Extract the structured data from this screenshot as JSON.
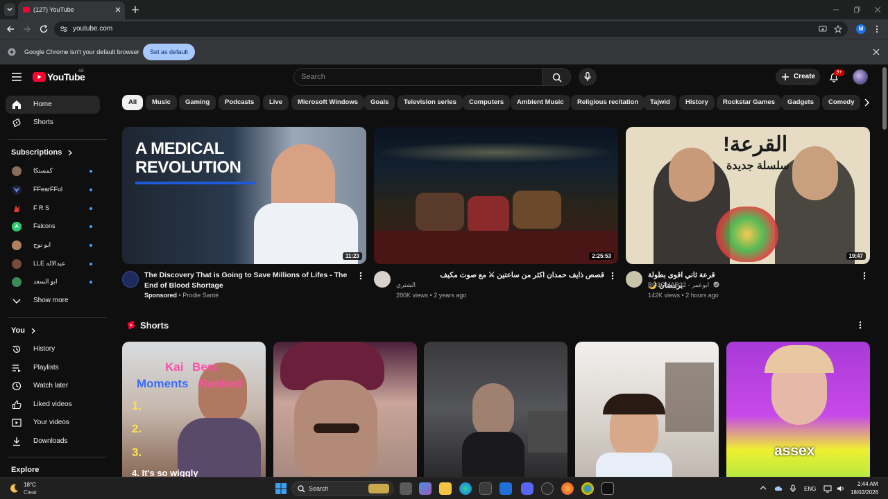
{
  "browser": {
    "tab_title": "(127) YouTube",
    "url": "youtube.com",
    "profile_initial": "M"
  },
  "infobar": {
    "message": "Google Chrome isn't your default browser",
    "button": "Set as default"
  },
  "masthead": {
    "logo_text": "YouTube",
    "country_code": "AE",
    "search_placeholder": "Search",
    "create_label": "Create",
    "notification_count": "9+"
  },
  "sidebar": {
    "main": [
      {
        "label": "Home",
        "icon": "home-icon",
        "active": true
      },
      {
        "label": "Shorts",
        "icon": "shorts-icon",
        "active": false
      }
    ],
    "subscriptions_heading": "Subscriptions",
    "subscriptions": [
      {
        "name": "كمستكا",
        "color": "#8a6d5a"
      },
      {
        "name": "FFearFFul",
        "color": "#2b3a8c"
      },
      {
        "name": "F R S",
        "color": "#c0392b"
      },
      {
        "name": "Falcons",
        "color": "#2ecc71"
      },
      {
        "name": "ابو نوح",
        "color": "#b08060"
      },
      {
        "name": "LLE عبدالاله",
        "color": "#7a4a3a"
      },
      {
        "name": "ابو السعد",
        "color": "#3a8a5a"
      }
    ],
    "show_more": "Show more",
    "you_heading": "You",
    "you_items": [
      {
        "label": "History",
        "icon": "history-icon"
      },
      {
        "label": "Playlists",
        "icon": "playlists-icon"
      },
      {
        "label": "Watch later",
        "icon": "watch-later-icon"
      },
      {
        "label": "Liked videos",
        "icon": "thumbs-up-icon"
      },
      {
        "label": "Your videos",
        "icon": "your-videos-icon"
      },
      {
        "label": "Downloads",
        "icon": "download-icon"
      }
    ],
    "explore_heading": "Explore"
  },
  "chips": [
    "All",
    "Music",
    "Gaming",
    "Podcasts",
    "Live",
    "Microsoft Windows",
    "Goals",
    "Television series",
    "Computers",
    "Ambient Music",
    "Religious recitation",
    "Tajwid",
    "History",
    "Rockstar Games",
    "Gadgets",
    "Comedy"
  ],
  "videos": [
    {
      "thumb_text_1": "A MEDICAL",
      "thumb_text_2": "REVOLUTION",
      "duration": "11:23",
      "title": "The Discovery That is Going to Save Millions of Lifes - The End of Blood Shortage",
      "sponsored": "Sponsored",
      "channel": "Prodie Santé"
    },
    {
      "duration": "2:25:53",
      "title": "قصص ذايف حمدان اكثر من ساعتين ⚔ مع صوت مكيف",
      "channel": "الشثري",
      "views": "280K views",
      "age": "2 years ago"
    },
    {
      "thumb_text_1": "القرعة!",
      "thumb_text_2": "سلسلة جديدة",
      "duration": "19:47",
      "title": "قرعة ثاني اقوى بطولة برمضان 🌙",
      "channel": "BO3OMAR22 - ابوعمر",
      "views": "142K views",
      "age": "2 hours ago"
    }
  ],
  "shorts": {
    "heading": "Shorts",
    "items": [
      {
        "overlay_1": "Kai",
        "overlay_2": "Best",
        "overlay_3": "Moments",
        "overlay_4": "Ranked",
        "list_1": "1.",
        "list_2": "2.",
        "list_3": "3.",
        "list_4": "4. It's so wiggly"
      },
      {},
      {},
      {},
      {
        "overlay": "assex"
      }
    ]
  },
  "taskbar": {
    "temperature": "18°C",
    "condition": "Clear",
    "search_label": "Search",
    "language": "ENG",
    "time": "2:44 AM",
    "date": "18/02/2026"
  }
}
